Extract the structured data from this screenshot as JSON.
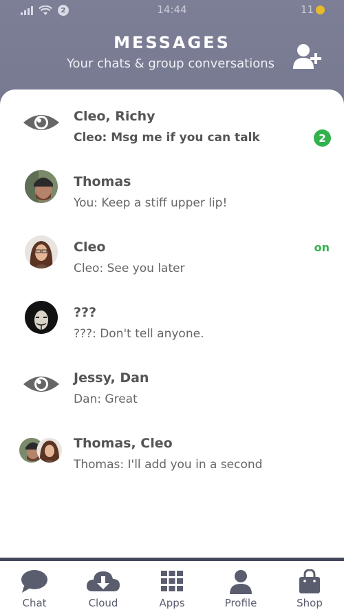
{
  "status": {
    "time": "14:44",
    "notifications": "2",
    "coins": "11"
  },
  "header": {
    "title": "MESSAGES",
    "subtitle": "Your chats & group conversations"
  },
  "conversations": [
    {
      "name": "Cleo, Richy",
      "preview": "Cleo: Msg me if you can talk",
      "unread": "2",
      "avatar": "eye-icon"
    },
    {
      "name": "Thomas",
      "preview": "You: Keep a stiff upper lip!",
      "avatar": "thomas-photo"
    },
    {
      "name": "Cleo",
      "preview": "Cleo: See you later",
      "status": "on",
      "avatar": "cleo-photo"
    },
    {
      "name": "???",
      "preview": "???: Don't tell anyone.",
      "avatar": "masked-photo"
    },
    {
      "name": "Jessy, Dan",
      "preview": "Dan: Great",
      "avatar": "eye-icon"
    },
    {
      "name": "Thomas, Cleo",
      "preview": "Thomas: I'll add you in a second",
      "avatar": "group-photo"
    }
  ],
  "tabs": [
    {
      "label": "Chat",
      "icon": "chat-bubble-icon"
    },
    {
      "label": "Cloud",
      "icon": "cloud-download-icon"
    },
    {
      "label": "Apps",
      "icon": "grid-icon"
    },
    {
      "label": "Profile",
      "icon": "person-icon"
    },
    {
      "label": "Shop",
      "icon": "shopping-bag-icon"
    }
  ],
  "colors": {
    "accent": "#32b24d",
    "header_top": "#7c7f96",
    "header_bottom": "#5c6077",
    "icon": "#5a5d6e"
  }
}
